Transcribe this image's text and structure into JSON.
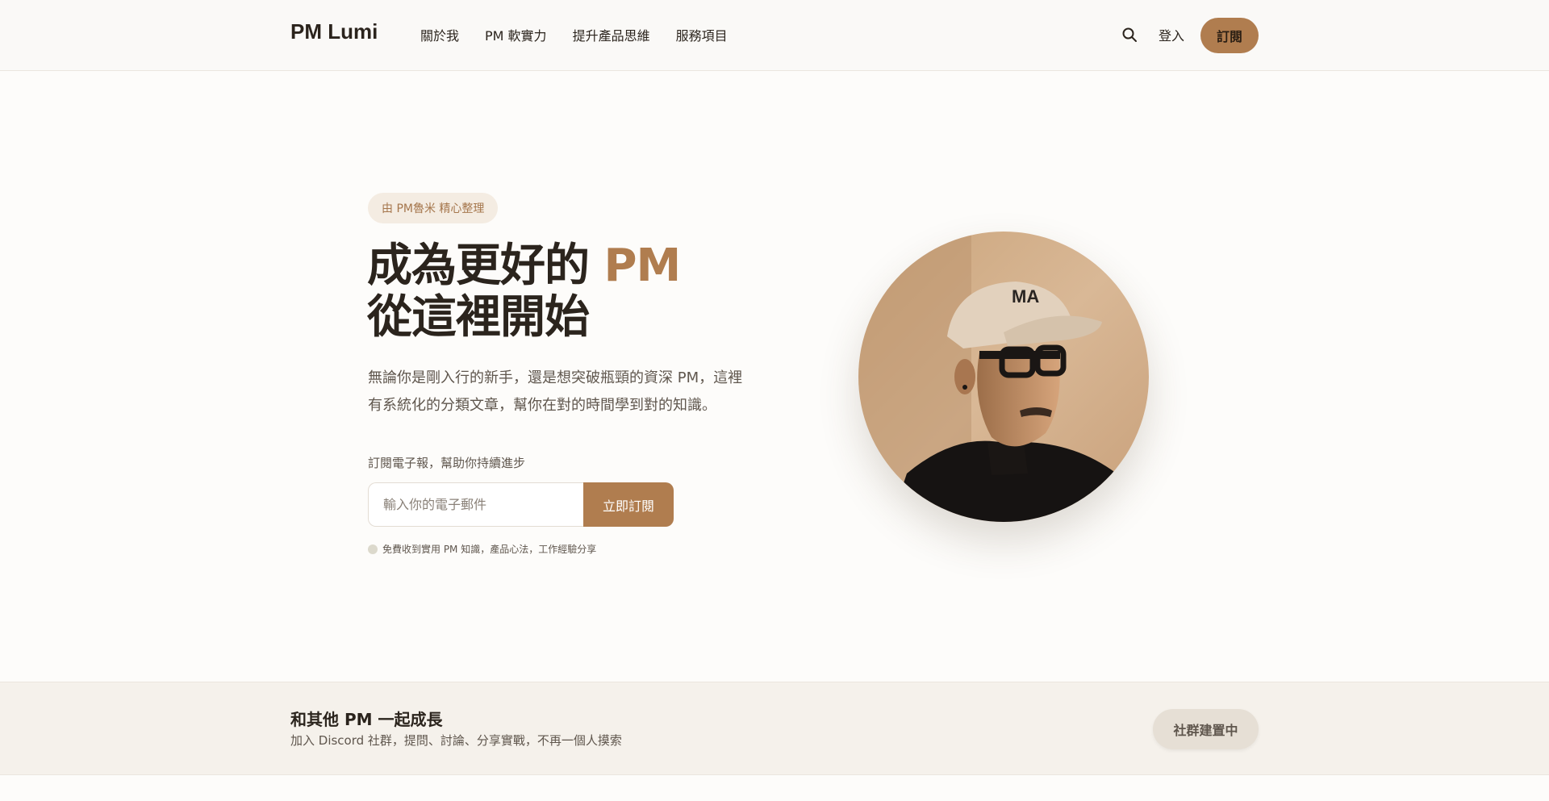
{
  "header": {
    "brand": "PM Lumi",
    "nav": [
      "關於我",
      "PM 軟實力",
      "提升產品思維",
      "服務項目"
    ],
    "login": "登入",
    "subscribe": "訂閱"
  },
  "hero": {
    "badge": "由 PM魯米 精心整理",
    "title_line1": "成為更好的 ",
    "title_accent": "PM",
    "title_line2": "從這裡開始",
    "description": "無論你是剛入行的新手，還是想突破瓶頸的資深 PM，這裡有系統化的分類文章，幫你在對的時間學到對的知識。",
    "newsletter_label": "訂閱電子報，幫助你持續進步",
    "email_placeholder": "輸入你的電子郵件",
    "subscribe_button": "立即訂閱",
    "note": "免費收到實用 PM 知識，產品心法，工作經驗分享"
  },
  "community": {
    "title": "和其他 PM 一起成長",
    "subtitle": "加入 Discord 社群，提問、討論、分享實戰，不再一個人摸索",
    "button": "社群建置中"
  },
  "colors": {
    "accent": "#b07d4f",
    "text": "#2b241d",
    "muted": "#5f564d"
  }
}
